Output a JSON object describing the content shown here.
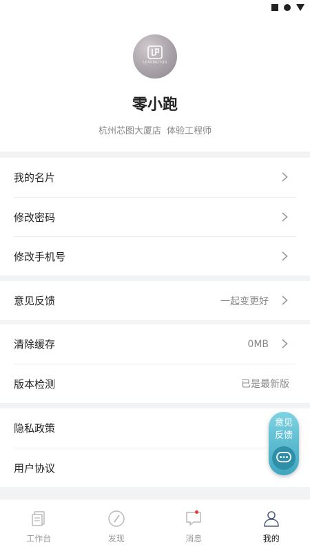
{
  "profile": {
    "name": "零小跑",
    "store": "杭州芯图大厦店",
    "role": "体验工程师",
    "avatar_text": "LEAPMOTOR"
  },
  "account": {
    "card": "我的名片",
    "change_password": "修改密码",
    "change_phone": "修改手机号"
  },
  "feedback": {
    "label": "意见反馈",
    "value": "一起变更好"
  },
  "cache": {
    "clear_label": "清除缓存",
    "clear_value": "0MB",
    "version_label": "版本检测",
    "version_value": "已是最新版"
  },
  "legal": {
    "privacy": "隐私政策",
    "agreement": "用户协议"
  },
  "float_button": {
    "label": "意见反馈"
  },
  "tabbar": {
    "workbench": "工作台",
    "discover": "发现",
    "messages": "消息",
    "mine": "我的"
  },
  "colors": {
    "accent": "#3fa6bf",
    "badge": "#e53935"
  }
}
